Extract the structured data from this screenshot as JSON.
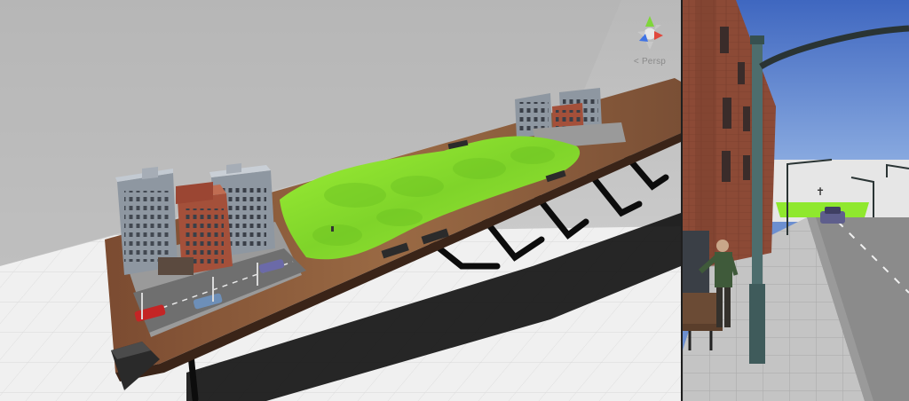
{
  "scene": {
    "gizmo": {
      "projection_label": "< Persp",
      "axis_colors": {
        "x": "#e0483d",
        "y": "#7fd63a",
        "z": "#3f73e5"
      }
    },
    "colors": {
      "terrain_green": "#8fe82e",
      "brick_red": "#a4503a",
      "stone_gray": "#8e97a1",
      "wood_brown": "#8a5a3a",
      "grid_white": "#f2f2f2"
    }
  },
  "game": {
    "colors": {
      "sky_top": "#3f67c0",
      "sky_bottom": "#8fb1e6",
      "road": "#8b8b8b",
      "sidewalk": "#c4c4c4"
    }
  }
}
